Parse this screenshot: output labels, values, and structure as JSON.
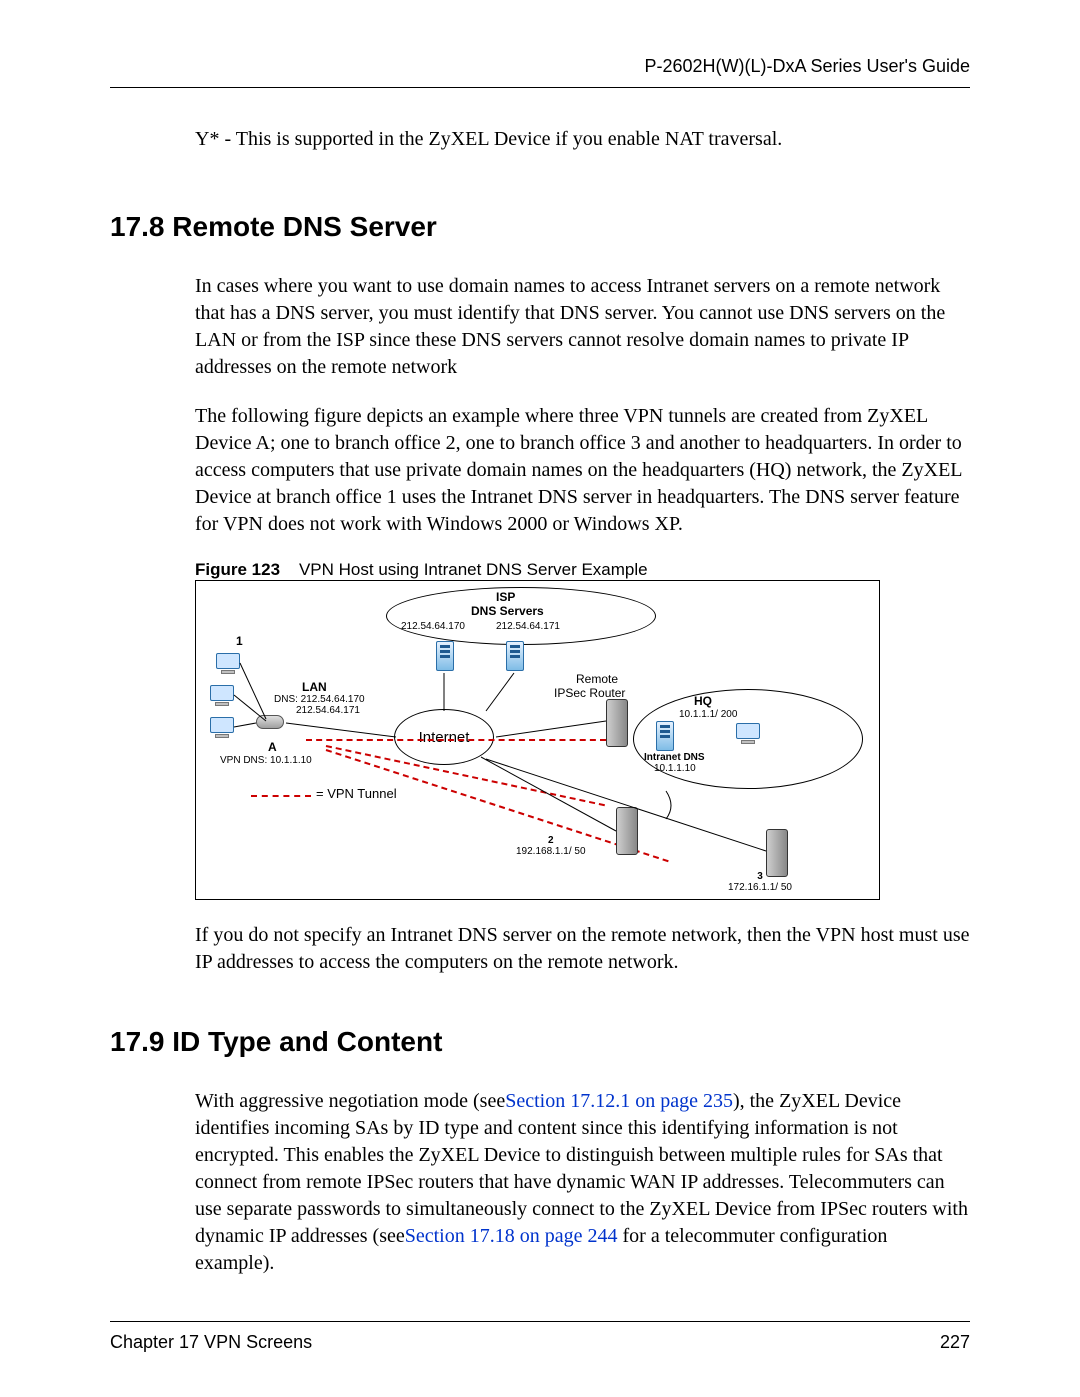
{
  "header": {
    "guide_title": "P-2602H(W)(L)-DxA Series User's Guide"
  },
  "footnote_text": "Y* - This is supported in the ZyXEL Device if you enable NAT traversal.",
  "sections": {
    "s178": {
      "heading": "17.8  Remote DNS Server",
      "para1": "In cases where you want to use domain names to access Intranet servers on a remote network that has a DNS server, you must identify that DNS server. You cannot use DNS servers on the LAN or from the ISP since these DNS servers cannot resolve domain names to private IP addresses on the remote network",
      "para2": "The following figure depicts an example where three VPN tunnels are created from ZyXEL Device A; one to branch office 2, one to branch office 3 and another to headquarters. In order to access computers that use private domain names on the headquarters (HQ) network, the ZyXEL Device at branch office 1 uses the Intranet DNS server in headquarters. The DNS server feature for VPN does not work with Windows 2000 or Windows XP.",
      "figure_label": "Figure 123",
      "figure_title": "VPN Host using Intranet DNS Server Example",
      "para3": "If you do not specify an Intranet DNS server on the remote network, then the VPN host must use IP addresses to access the computers on the remote network."
    },
    "s179": {
      "heading": "17.9  ID Type and Content",
      "para1_a": "With aggressive negotiation mode (see",
      "link1": "Section 17.12.1 on page 235",
      "para1_b": "), the ZyXEL Device identifies incoming SAs by ID type and content since this identifying information is not encrypted. This enables the ZyXEL Device to distinguish between multiple rules for SAs that connect from remote IPSec routers that have dynamic WAN IP addresses. Telecommuters can use separate passwords to simultaneously connect to the ZyXEL Device from IPSec routers with dynamic IP addresses (see",
      "link2": "Section 17.18 on page 244",
      "para1_c": " for a telecommuter configuration example)."
    }
  },
  "diagram": {
    "isp_label": "ISP",
    "dns_servers_label": "DNS Servers",
    "isp_ip1": "212.54.64.170",
    "isp_ip2": "212.54.64.171",
    "branch1": "1",
    "lan_label": "LAN",
    "lan_dns_line1": "DNS: 212.54.64.170",
    "lan_dns_line2": "212.54.64.171",
    "a_label": "A",
    "a_vpn_dns": "VPN DNS: 10.1.1.10",
    "internet_label": "Internet",
    "remote_label": "Remote",
    "ipsec_router_label": "IPSec Router",
    "hq_label": "HQ",
    "hq_net": "10.1.1.1/ 200",
    "intranet_dns_label": "Intranet DNS",
    "intranet_dns_ip": "10.1.1.10",
    "vpn_tunnel_legend": "= VPN Tunnel",
    "branch2": "2",
    "branch2_net": "192.168.1.1/ 50",
    "branch3": "3",
    "branch3_net": "172.16.1.1/ 50"
  },
  "footer": {
    "chapter": "Chapter 17 VPN Screens",
    "page": "227"
  }
}
